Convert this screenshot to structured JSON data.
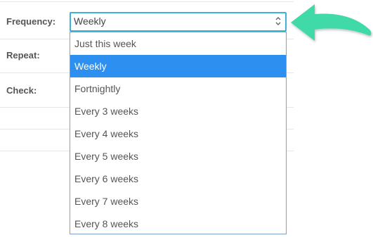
{
  "form": {
    "labels": {
      "frequency": "Frequency:",
      "repeat": "Repeat:",
      "check": "Check:"
    },
    "frequency_select": {
      "value": "Weekly",
      "options": [
        "Just this week",
        "Weekly",
        "Fortnightly",
        "Every 3 weeks",
        "Every 4 weeks",
        "Every 5 weeks",
        "Every 6 weeks",
        "Every 7 weeks",
        "Every 8 weeks"
      ],
      "selected_option": "Weekly"
    }
  },
  "colors": {
    "select_border": "#3cb3d6",
    "highlight": "#2d8ff0",
    "label": "#555555",
    "arrow": "#3fd9a8"
  },
  "icons": {
    "annotation": "curved-arrow-icon",
    "select_toggle": "updown-chevron-icon"
  }
}
